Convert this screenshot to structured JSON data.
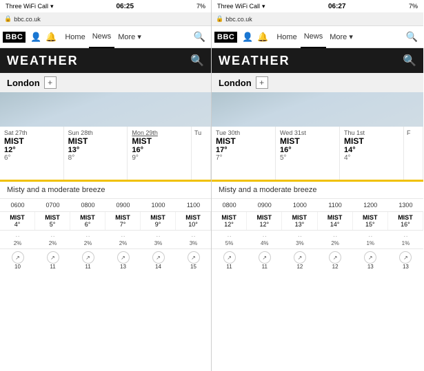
{
  "panel1": {
    "status": {
      "carrier": "Three WiFi Call",
      "time": "06:25",
      "battery": "7%",
      "url": "bbc.co.uk"
    },
    "nav": {
      "logo": "BBC",
      "home": "Home",
      "news": "News",
      "more": "More ▾",
      "search_icon": "🔍"
    },
    "weather": {
      "title": "WEATHER",
      "location": "London",
      "add_label": "+",
      "description": "Misty and a moderate breeze"
    },
    "forecast": [
      {
        "day": "Sat 27th",
        "condition": "MIST",
        "high": "12°",
        "low": "6°",
        "active": true
      },
      {
        "day": "Sun 28th",
        "condition": "MIST",
        "high": "13°",
        "low": "8°",
        "active": false
      },
      {
        "day": "Mon 29th",
        "condition": "MIST",
        "high": "16°",
        "low": "9°",
        "active": false,
        "underline": true
      },
      {
        "day": "Tu",
        "condition": "",
        "high": "",
        "low": "",
        "partial": true
      }
    ],
    "hourly": {
      "times": [
        "0600",
        "0700",
        "0800",
        "0900",
        "1000",
        "1100"
      ],
      "conditions": [
        "MIST",
        "MIST",
        "MIST",
        "MIST",
        "MIST",
        "MIST"
      ],
      "temps": [
        "4°",
        "5°",
        "6°",
        "7°",
        "9°",
        "10°"
      ],
      "precip": [
        "2%",
        "2%",
        "2%",
        "2%",
        "3%",
        "3%"
      ],
      "wind": [
        "10",
        "11",
        "11",
        "13",
        "14",
        "15"
      ]
    }
  },
  "panel2": {
    "status": {
      "carrier": "Three WiFi Call",
      "time": "06:27",
      "battery": "7%",
      "url": "bbc.co.uk"
    },
    "nav": {
      "logo": "BBC",
      "home": "Home",
      "news": "News",
      "more": "More ▾",
      "search_icon": "🔍"
    },
    "weather": {
      "title": "WEATHER",
      "location": "London",
      "add_label": "+",
      "description": "Misty and a moderate breeze"
    },
    "forecast": [
      {
        "day": "Tue 30th",
        "condition": "MIST",
        "high": "17°",
        "low": "7°",
        "active": true
      },
      {
        "day": "Wed 31st",
        "condition": "MIST",
        "high": "16°",
        "low": "5°",
        "active": false
      },
      {
        "day": "Thu 1st",
        "condition": "MIST",
        "high": "14°",
        "low": "4°",
        "active": false
      },
      {
        "day": "F",
        "condition": "",
        "high": "",
        "low": "",
        "partial": true
      }
    ],
    "hourly": {
      "times": [
        "0800",
        "0900",
        "1000",
        "1100",
        "1200",
        "1300"
      ],
      "conditions": [
        "MIST",
        "MIST",
        "MIST",
        "MIST",
        "MIST",
        "MIST"
      ],
      "temps": [
        "12°",
        "12°",
        "13°",
        "14°",
        "15°",
        "16°"
      ],
      "precip": [
        "5%",
        "4%",
        "3%",
        "2%",
        "1%",
        "1%"
      ],
      "wind": [
        "11",
        "11",
        "12",
        "12",
        "13",
        "13"
      ]
    }
  }
}
